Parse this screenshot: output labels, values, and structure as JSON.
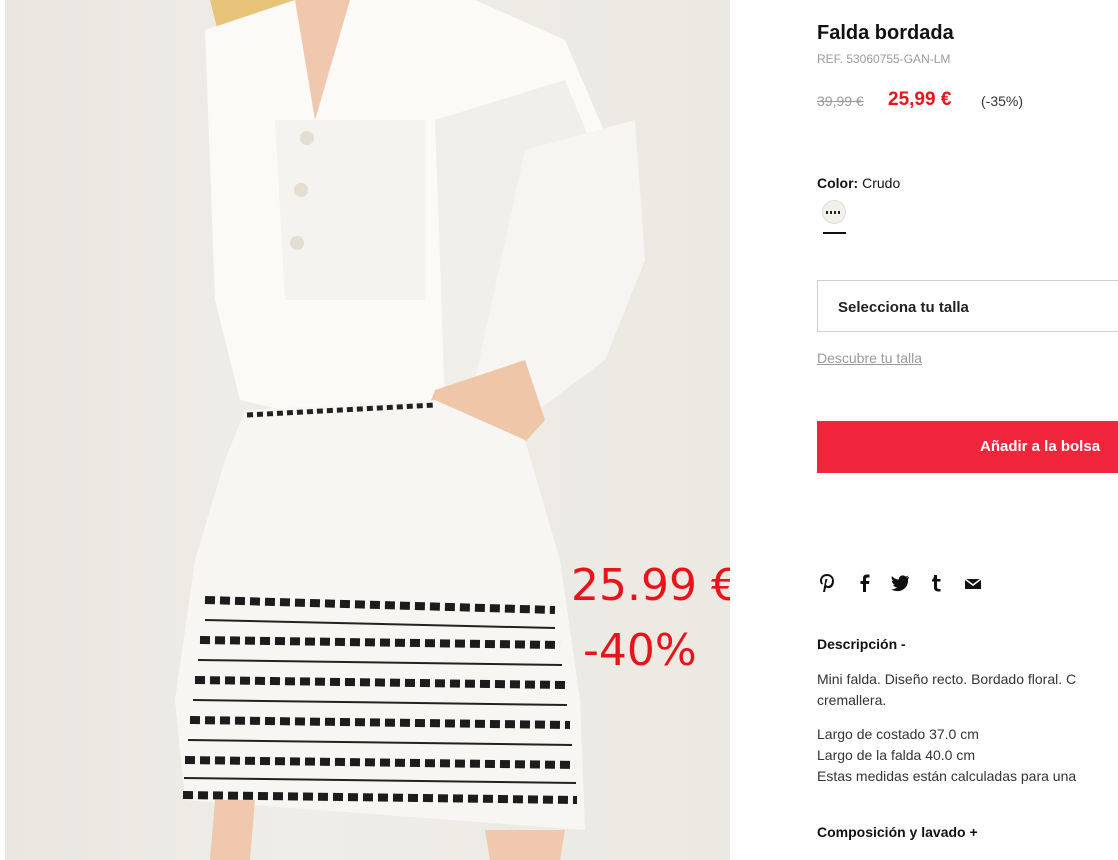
{
  "product": {
    "title": "Falda bordada",
    "ref": "REF. 53060755-GAN-LM",
    "old_price": "39,99 €",
    "new_price": "25,99 €",
    "discount": "(-35%)",
    "color_label": "Color:",
    "color_value": "Crudo",
    "size_placeholder": "Selecciona tu talla",
    "size_guide_link": "Descubre tu talla",
    "add_to_bag": "Añadir a la bolsa"
  },
  "overlay": {
    "price": "25.99 €",
    "discount": "-40%"
  },
  "social": {
    "icons": [
      "pinterest-icon",
      "facebook-icon",
      "twitter-icon",
      "tumblr-icon",
      "email-icon"
    ]
  },
  "description": {
    "heading": "Descripción -",
    "lines": [
      "Mini falda. Diseño recto. Bordado floral. C",
      "cremallera."
    ],
    "measures": [
      "Largo de costado 37.0 cm",
      "Largo de la falda 40.0 cm",
      "Estas medidas están calculadas para una"
    ]
  },
  "composition": {
    "heading": "Composición y lavado  +"
  },
  "colors": {
    "accent": "#f0243a",
    "price_red": "#e8141b",
    "muted": "#9a9a9a"
  }
}
